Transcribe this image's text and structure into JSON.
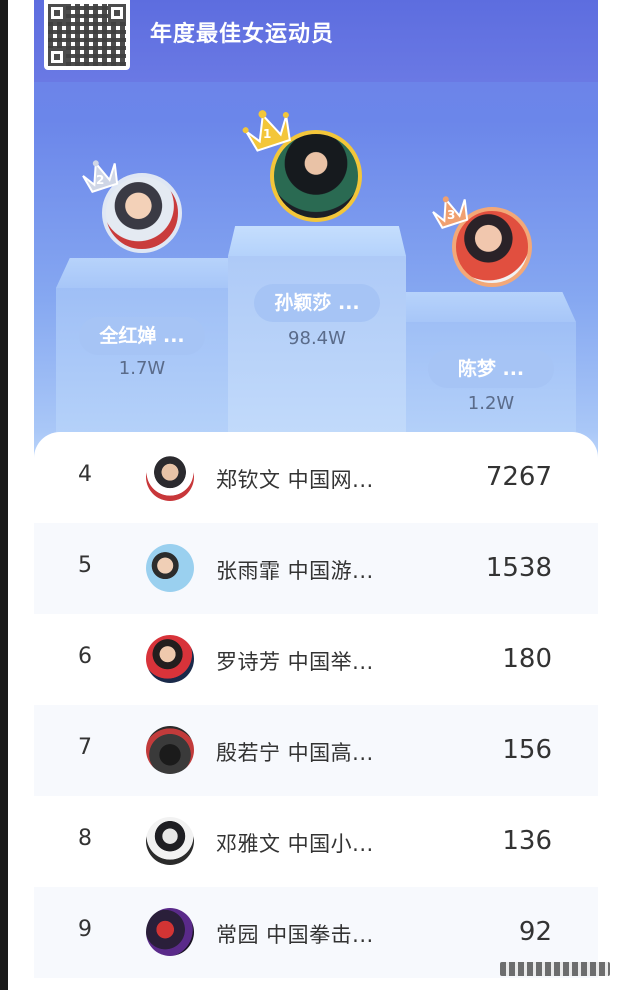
{
  "header": {
    "title": "年度最佳女运动员"
  },
  "podium": [
    {
      "rank": "2",
      "name": "全红婵 ...",
      "score": "1.7W"
    },
    {
      "rank": "1",
      "name": "孙颖莎 ...",
      "score": "98.4W"
    },
    {
      "rank": "3",
      "name": "陈梦 ...",
      "score": "1.2W"
    }
  ],
  "list": [
    {
      "rank": "4",
      "name": "郑钦文 中国网...",
      "value": "7267"
    },
    {
      "rank": "5",
      "name": "张雨霏 中国游...",
      "value": "1538"
    },
    {
      "rank": "6",
      "name": "罗诗芳 中国举...",
      "value": "180"
    },
    {
      "rank": "7",
      "name": "殷若宁 中国高...",
      "value": "156"
    },
    {
      "rank": "8",
      "name": "邓雅文 中国小...",
      "value": "136"
    },
    {
      "rank": "9",
      "name": "常园 中国拳击...",
      "value": "92"
    }
  ],
  "colors": {
    "header": "#6373e2",
    "gold": "#f3c63a",
    "silver": "#c8cfe0",
    "bronze": "#f0a070",
    "pill": "#a6c4f5"
  }
}
